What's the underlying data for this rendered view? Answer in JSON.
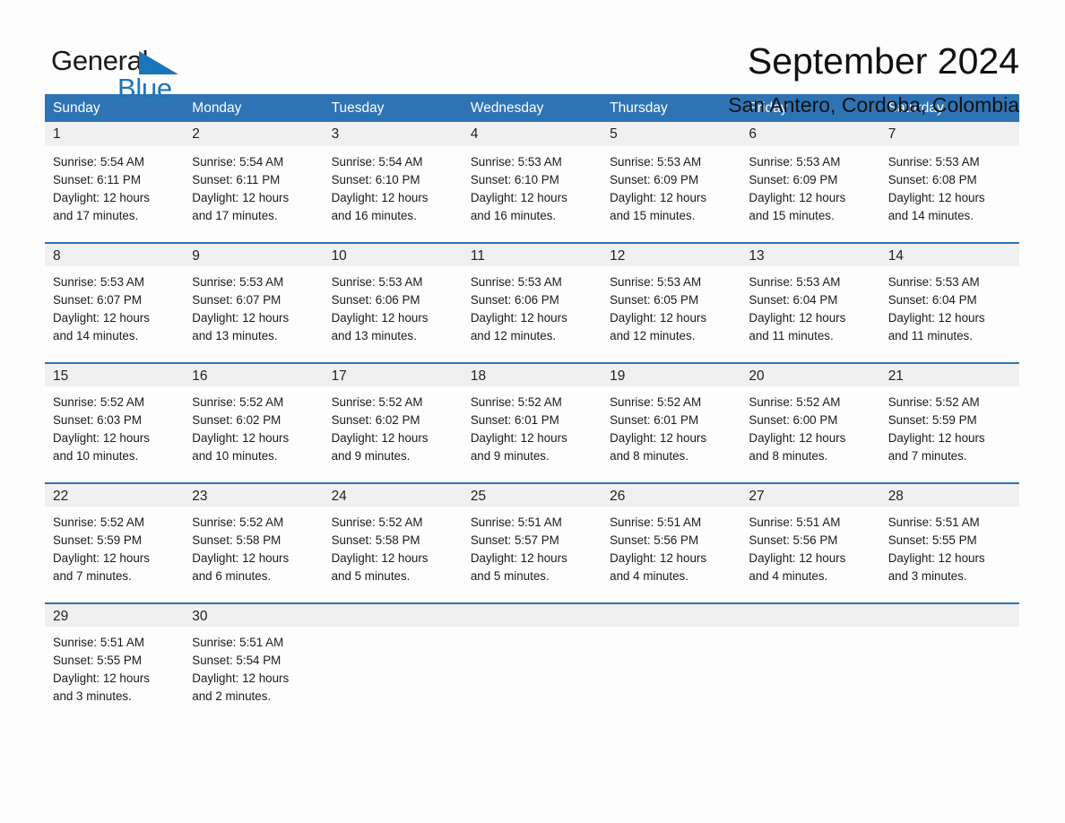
{
  "brand": {
    "name_part1": "General",
    "name_part2": "Blue",
    "accent_color": "#1b75bb"
  },
  "header": {
    "month_title": "September 2024",
    "location": "San Antero, Cordoba, Colombia"
  },
  "theme": {
    "header_blue": "#2e74b5",
    "daynum_band_gray": "#f0f0f0",
    "cell_white": "#fdfdfd",
    "text_dark": "#1b1b1b"
  },
  "weekdays": [
    "Sunday",
    "Monday",
    "Tuesday",
    "Wednesday",
    "Thursday",
    "Friday",
    "Saturday"
  ],
  "weeks": [
    {
      "days": [
        {
          "num": "1",
          "sunrise": "Sunrise: 5:54 AM",
          "sunset": "Sunset: 6:11 PM",
          "daylight_line1": "Daylight: 12 hours",
          "daylight_line2": "and 17 minutes."
        },
        {
          "num": "2",
          "sunrise": "Sunrise: 5:54 AM",
          "sunset": "Sunset: 6:11 PM",
          "daylight_line1": "Daylight: 12 hours",
          "daylight_line2": "and 17 minutes."
        },
        {
          "num": "3",
          "sunrise": "Sunrise: 5:54 AM",
          "sunset": "Sunset: 6:10 PM",
          "daylight_line1": "Daylight: 12 hours",
          "daylight_line2": "and 16 minutes."
        },
        {
          "num": "4",
          "sunrise": "Sunrise: 5:53 AM",
          "sunset": "Sunset: 6:10 PM",
          "daylight_line1": "Daylight: 12 hours",
          "daylight_line2": "and 16 minutes."
        },
        {
          "num": "5",
          "sunrise": "Sunrise: 5:53 AM",
          "sunset": "Sunset: 6:09 PM",
          "daylight_line1": "Daylight: 12 hours",
          "daylight_line2": "and 15 minutes."
        },
        {
          "num": "6",
          "sunrise": "Sunrise: 5:53 AM",
          "sunset": "Sunset: 6:09 PM",
          "daylight_line1": "Daylight: 12 hours",
          "daylight_line2": "and 15 minutes."
        },
        {
          "num": "7",
          "sunrise": "Sunrise: 5:53 AM",
          "sunset": "Sunset: 6:08 PM",
          "daylight_line1": "Daylight: 12 hours",
          "daylight_line2": "and 14 minutes."
        }
      ]
    },
    {
      "days": [
        {
          "num": "8",
          "sunrise": "Sunrise: 5:53 AM",
          "sunset": "Sunset: 6:07 PM",
          "daylight_line1": "Daylight: 12 hours",
          "daylight_line2": "and 14 minutes."
        },
        {
          "num": "9",
          "sunrise": "Sunrise: 5:53 AM",
          "sunset": "Sunset: 6:07 PM",
          "daylight_line1": "Daylight: 12 hours",
          "daylight_line2": "and 13 minutes."
        },
        {
          "num": "10",
          "sunrise": "Sunrise: 5:53 AM",
          "sunset": "Sunset: 6:06 PM",
          "daylight_line1": "Daylight: 12 hours",
          "daylight_line2": "and 13 minutes."
        },
        {
          "num": "11",
          "sunrise": "Sunrise: 5:53 AM",
          "sunset": "Sunset: 6:06 PM",
          "daylight_line1": "Daylight: 12 hours",
          "daylight_line2": "and 12 minutes."
        },
        {
          "num": "12",
          "sunrise": "Sunrise: 5:53 AM",
          "sunset": "Sunset: 6:05 PM",
          "daylight_line1": "Daylight: 12 hours",
          "daylight_line2": "and 12 minutes."
        },
        {
          "num": "13",
          "sunrise": "Sunrise: 5:53 AM",
          "sunset": "Sunset: 6:04 PM",
          "daylight_line1": "Daylight: 12 hours",
          "daylight_line2": "and 11 minutes."
        },
        {
          "num": "14",
          "sunrise": "Sunrise: 5:53 AM",
          "sunset": "Sunset: 6:04 PM",
          "daylight_line1": "Daylight: 12 hours",
          "daylight_line2": "and 11 minutes."
        }
      ]
    },
    {
      "days": [
        {
          "num": "15",
          "sunrise": "Sunrise: 5:52 AM",
          "sunset": "Sunset: 6:03 PM",
          "daylight_line1": "Daylight: 12 hours",
          "daylight_line2": "and 10 minutes."
        },
        {
          "num": "16",
          "sunrise": "Sunrise: 5:52 AM",
          "sunset": "Sunset: 6:02 PM",
          "daylight_line1": "Daylight: 12 hours",
          "daylight_line2": "and 10 minutes."
        },
        {
          "num": "17",
          "sunrise": "Sunrise: 5:52 AM",
          "sunset": "Sunset: 6:02 PM",
          "daylight_line1": "Daylight: 12 hours",
          "daylight_line2": "and 9 minutes."
        },
        {
          "num": "18",
          "sunrise": "Sunrise: 5:52 AM",
          "sunset": "Sunset: 6:01 PM",
          "daylight_line1": "Daylight: 12 hours",
          "daylight_line2": "and 9 minutes."
        },
        {
          "num": "19",
          "sunrise": "Sunrise: 5:52 AM",
          "sunset": "Sunset: 6:01 PM",
          "daylight_line1": "Daylight: 12 hours",
          "daylight_line2": "and 8 minutes."
        },
        {
          "num": "20",
          "sunrise": "Sunrise: 5:52 AM",
          "sunset": "Sunset: 6:00 PM",
          "daylight_line1": "Daylight: 12 hours",
          "daylight_line2": "and 8 minutes."
        },
        {
          "num": "21",
          "sunrise": "Sunrise: 5:52 AM",
          "sunset": "Sunset: 5:59 PM",
          "daylight_line1": "Daylight: 12 hours",
          "daylight_line2": "and 7 minutes."
        }
      ]
    },
    {
      "days": [
        {
          "num": "22",
          "sunrise": "Sunrise: 5:52 AM",
          "sunset": "Sunset: 5:59 PM",
          "daylight_line1": "Daylight: 12 hours",
          "daylight_line2": "and 7 minutes."
        },
        {
          "num": "23",
          "sunrise": "Sunrise: 5:52 AM",
          "sunset": "Sunset: 5:58 PM",
          "daylight_line1": "Daylight: 12 hours",
          "daylight_line2": "and 6 minutes."
        },
        {
          "num": "24",
          "sunrise": "Sunrise: 5:52 AM",
          "sunset": "Sunset: 5:58 PM",
          "daylight_line1": "Daylight: 12 hours",
          "daylight_line2": "and 5 minutes."
        },
        {
          "num": "25",
          "sunrise": "Sunrise: 5:51 AM",
          "sunset": "Sunset: 5:57 PM",
          "daylight_line1": "Daylight: 12 hours",
          "daylight_line2": "and 5 minutes."
        },
        {
          "num": "26",
          "sunrise": "Sunrise: 5:51 AM",
          "sunset": "Sunset: 5:56 PM",
          "daylight_line1": "Daylight: 12 hours",
          "daylight_line2": "and 4 minutes."
        },
        {
          "num": "27",
          "sunrise": "Sunrise: 5:51 AM",
          "sunset": "Sunset: 5:56 PM",
          "daylight_line1": "Daylight: 12 hours",
          "daylight_line2": "and 4 minutes."
        },
        {
          "num": "28",
          "sunrise": "Sunrise: 5:51 AM",
          "sunset": "Sunset: 5:55 PM",
          "daylight_line1": "Daylight: 12 hours",
          "daylight_line2": "and 3 minutes."
        }
      ]
    },
    {
      "days": [
        {
          "num": "29",
          "sunrise": "Sunrise: 5:51 AM",
          "sunset": "Sunset: 5:55 PM",
          "daylight_line1": "Daylight: 12 hours",
          "daylight_line2": "and 3 minutes."
        },
        {
          "num": "30",
          "sunrise": "Sunrise: 5:51 AM",
          "sunset": "Sunset: 5:54 PM",
          "daylight_line1": "Daylight: 12 hours",
          "daylight_line2": "and 2 minutes."
        },
        {
          "num": "",
          "sunrise": "",
          "sunset": "",
          "daylight_line1": "",
          "daylight_line2": ""
        },
        {
          "num": "",
          "sunrise": "",
          "sunset": "",
          "daylight_line1": "",
          "daylight_line2": ""
        },
        {
          "num": "",
          "sunrise": "",
          "sunset": "",
          "daylight_line1": "",
          "daylight_line2": ""
        },
        {
          "num": "",
          "sunrise": "",
          "sunset": "",
          "daylight_line1": "",
          "daylight_line2": ""
        },
        {
          "num": "",
          "sunrise": "",
          "sunset": "",
          "daylight_line1": "",
          "daylight_line2": ""
        }
      ]
    }
  ]
}
